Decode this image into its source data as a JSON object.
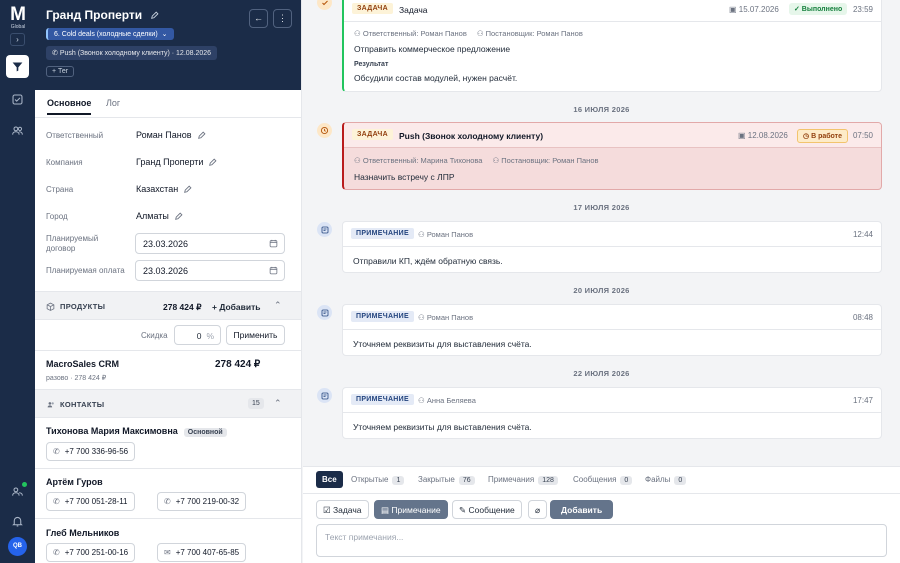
{
  "rail": {
    "logo": "M",
    "logo_sub": "Global",
    "collapse_icon": "chevron-right-icon",
    "items": [
      "filter-icon",
      "checkbox-icon",
      "users-icon"
    ],
    "bottom": [
      "user-plus-icon",
      "bell-icon"
    ],
    "avatar": "QB"
  },
  "deal": {
    "title": "Гранд Проперти",
    "stage": "6. Cold deals (холодные сделки)",
    "activity": "Push (Звонок холодному клиенту) · 12.08.2026",
    "tag_button": "+ Тег",
    "back_icon": "←",
    "more_icon": "⋮"
  },
  "tabs": [
    "Основное",
    "Лог"
  ],
  "fields": [
    {
      "label": "Ответственный",
      "value": "Роман Панов"
    },
    {
      "label": "Компания",
      "value": "Гранд Проперти"
    },
    {
      "label": "Страна",
      "value": "Казахстан"
    },
    {
      "label": "Город",
      "value": "Алматы"
    }
  ],
  "dates": [
    {
      "label": "Планируемый договор",
      "value": "23.03.2026"
    },
    {
      "label": "Планируемая оплата",
      "value": "23.03.2026"
    }
  ],
  "products": {
    "title": "ПРОДУКТЫ",
    "total": "278 424 ₽",
    "add_label": "+ Добавить",
    "discount_label": "Скидка",
    "discount_value": "0",
    "discount_unit": "%",
    "apply_label": "Применить",
    "items": [
      {
        "name": "MacroSales CRM",
        "sub": "разово · 278 424 ₽",
        "price": "278 424 ₽"
      }
    ]
  },
  "contacts": {
    "title": "КОНТАКТЫ",
    "count": "15",
    "main_badge": "Основной",
    "items": [
      {
        "name": "Тихонова Мария Максимовна",
        "phones": [
          "+7 700 336-96-56"
        ]
      },
      {
        "name": "Артём Гуров",
        "phones": [
          "+7 700 051-28-11",
          "+7 700 219-00-32"
        ]
      },
      {
        "name": "Глеб Мельников",
        "phones": [
          "+7 700 251-00-16",
          "+7 700 407-65-85"
        ]
      }
    ]
  },
  "timeline": {
    "card1": {
      "kind": "ЗАДАЧА",
      "subject": "Задача",
      "date": "15.07.2026",
      "status": "✓ Выполнено",
      "time": "23:59",
      "responsible": "Ответственный: Роман Панов",
      "setter": "Постановщик: Роман Панов",
      "text": "Отправить коммерческое предложение",
      "result_label": "Результат",
      "result": "Обсудили состав модулей, нужен расчёт."
    },
    "day1": "16 ИЮЛЯ 2026",
    "card2": {
      "kind": "ЗАДАЧА",
      "subject": "Push (Звонок холодному клиенту)",
      "date": "12.08.2026",
      "status": "В работе",
      "time": "07:50",
      "responsible": "Ответственный: Марина Тихонова",
      "setter": "Постановщик: Роман Панов",
      "text": "Назначить встречу с ЛПР"
    },
    "day2": "17 ИЮЛЯ 2026",
    "card3": {
      "kind": "ПРИМЕЧАНИЕ",
      "author": "Роман Панов",
      "time": "12:44",
      "text": "Отправили КП, ждём обратную связь."
    },
    "day3": "20 ИЮЛЯ 2026",
    "card4": {
      "kind": "ПРИМЕЧАНИЕ",
      "author": "Роман Панов",
      "time": "08:48",
      "text": "Уточняем реквизиты для выставления счёта."
    },
    "day4": "22 ИЮЛЯ 2026",
    "card5": {
      "kind": "ПРИМЕЧАНИЕ",
      "author": "Анна Беляева",
      "time": "17:47",
      "text": "Уточняем реквизиты для выставления счёта."
    }
  },
  "filters": [
    {
      "label": "Все"
    },
    {
      "label": "Открытые",
      "count": "1"
    },
    {
      "label": "Закрытые",
      "count": "76"
    },
    {
      "label": "Примечания",
      "count": "128"
    },
    {
      "label": "Сообщения",
      "count": "0"
    },
    {
      "label": "Файлы",
      "count": "0"
    }
  ],
  "composer": {
    "task": "Задача",
    "note": "Примечание",
    "message": "Сообщение",
    "add": "Добавить",
    "placeholder": "Текст примечания..."
  }
}
